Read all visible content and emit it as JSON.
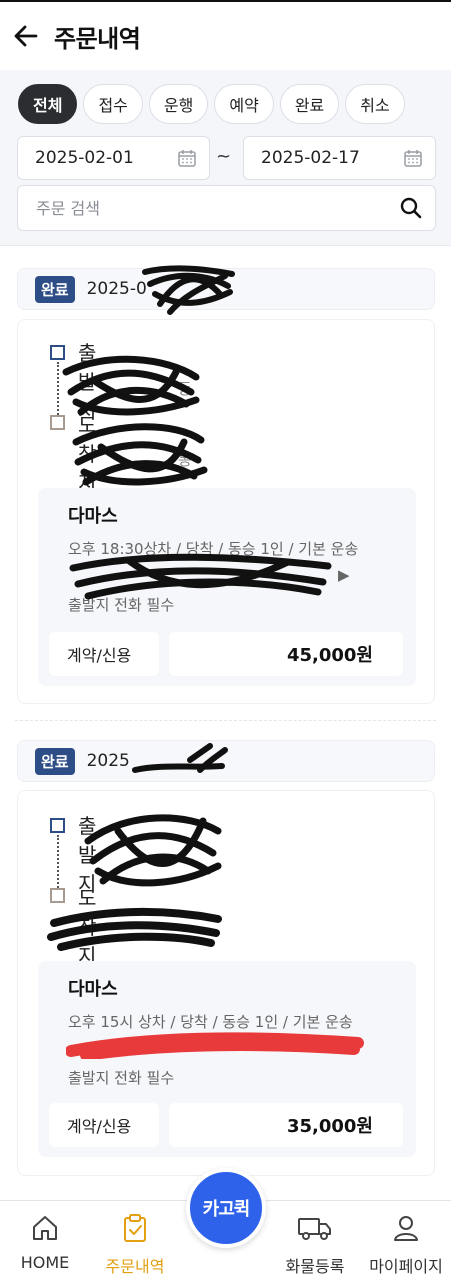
{
  "header": {
    "title": "주문내역"
  },
  "filters": {
    "chips": [
      {
        "label": "전체",
        "active": true
      },
      {
        "label": "접수",
        "active": false
      },
      {
        "label": "운행",
        "active": false
      },
      {
        "label": "예약",
        "active": false
      },
      {
        "label": "완료",
        "active": false
      },
      {
        "label": "취소",
        "active": false
      }
    ],
    "date_from": "2025-02-01",
    "date_sep": "~",
    "date_to": "2025-02-17",
    "search_placeholder": "주문 검색"
  },
  "orders": [
    {
      "status": "완료",
      "date": "2025-0",
      "origin_label": "출발지",
      "dest_label": "도착지",
      "origin_sub_fragment": "동",
      "dest_sub_fragment": "동",
      "company": "다마스",
      "detail_line1": "오후 18:30상차 / 당착 / 동승 1인 / 기본 운송",
      "detail_line2": "▶",
      "detail_line3": "출발지 전화 필수",
      "payment": "계약/신용",
      "price": "45,000원"
    },
    {
      "status": "완료",
      "date": "2025",
      "origin_label": "출발지",
      "dest_label": "도착지",
      "company": "다마스",
      "detail_line1": "오후 15시 상차 / 당착 / 동승 1인 / 기본 운송",
      "detail_line3": "출발지 전화 필수",
      "payment": "계약/신용",
      "price": "35,000원"
    }
  ],
  "fab_label": "카고퀵",
  "bottom_nav": [
    {
      "label": "HOME",
      "icon": "home-icon",
      "active": false
    },
    {
      "label": "주문내역",
      "icon": "order-list-icon",
      "active": true
    },
    {
      "label": "화물등록",
      "icon": "truck-icon",
      "active": false
    },
    {
      "label": "마이페이지",
      "icon": "person-icon",
      "active": false
    }
  ],
  "colors": {
    "badge": "#2d4d86",
    "active_nav": "#e2a012",
    "fab": "#2e62ea"
  }
}
